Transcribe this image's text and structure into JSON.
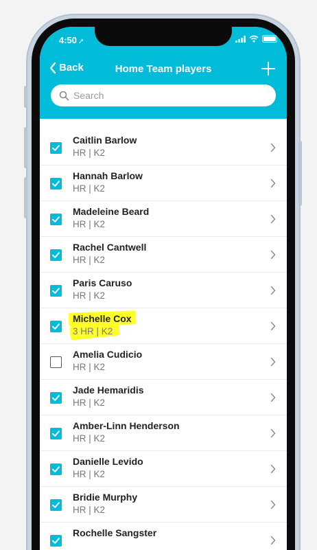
{
  "status_bar": {
    "time": "4:50"
  },
  "nav": {
    "back_label": "Back",
    "title": "Home Team players"
  },
  "search": {
    "placeholder": "Search"
  },
  "colors": {
    "accent": "#00bcd8",
    "highlight": "#ffff2a"
  },
  "players": [
    {
      "name": "Caitlin Barlow",
      "detail": "HR | K2",
      "checked": true
    },
    {
      "name": "Hannah Barlow",
      "detail": "HR | K2",
      "checked": true
    },
    {
      "name": "Madeleine Beard",
      "detail": "HR | K2",
      "checked": true
    },
    {
      "name": "Rachel Cantwell",
      "detail": "HR | K2",
      "checked": true
    },
    {
      "name": "Paris Caruso",
      "detail": "HR | K2",
      "checked": true
    },
    {
      "name": "Michelle Cox",
      "detail": "3 HR | K2",
      "checked": true,
      "highlighted": true
    },
    {
      "name": "Amelia Cudicio",
      "detail": "HR | K2",
      "checked": false
    },
    {
      "name": "Jade Hemaridis",
      "detail": "HR | K2",
      "checked": true
    },
    {
      "name": "Amber-Linn Henderson",
      "detail": "HR | K2",
      "checked": true
    },
    {
      "name": "Danielle Levido",
      "detail": "HR | K2",
      "checked": true
    },
    {
      "name": "Bridie Murphy",
      "detail": "HR | K2",
      "checked": true
    },
    {
      "name": "Rochelle Sangster",
      "detail": "",
      "checked": true
    }
  ]
}
